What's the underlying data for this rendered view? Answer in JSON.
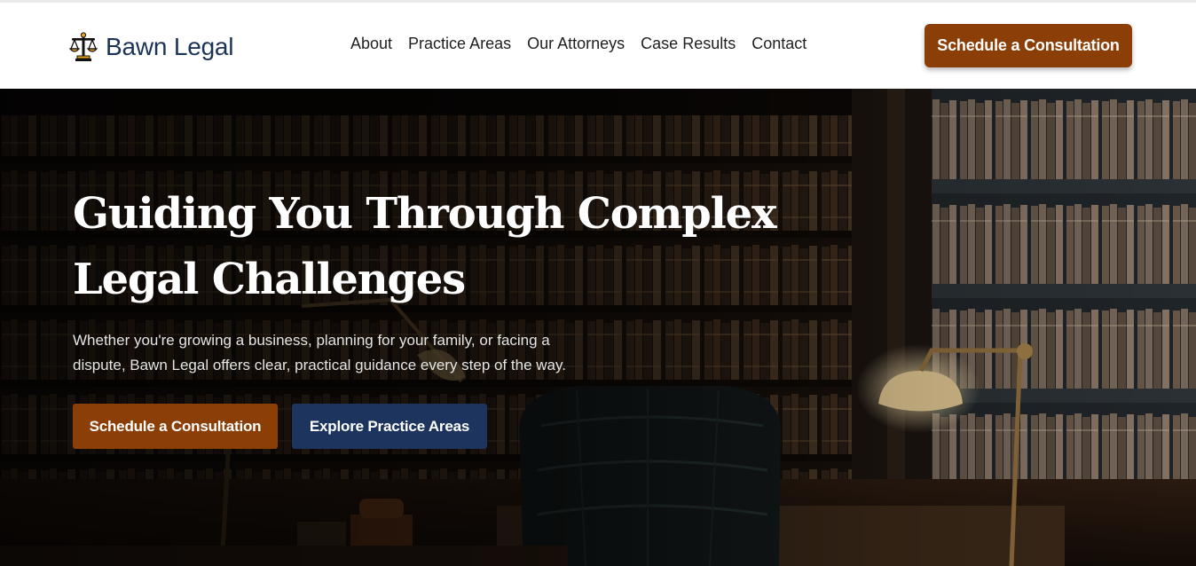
{
  "brand": {
    "name": "Bawn Legal",
    "icon": "scales-of-justice-icon"
  },
  "nav": {
    "items": [
      {
        "label": "About"
      },
      {
        "label": "Practice Areas"
      },
      {
        "label": "Our Attorneys"
      },
      {
        "label": "Case Results"
      },
      {
        "label": "Contact"
      }
    ]
  },
  "header": {
    "cta_label": "Schedule a Consultation"
  },
  "hero": {
    "title": "Guiding You Through Complex Legal Challenges",
    "subtitle": "Whether you're growing a business, planning for your family, or facing a dispute, Bawn Legal offers clear, practical guidance every step of the way.",
    "primary_button": "Schedule a Consultation",
    "secondary_button": "Explore Practice Areas",
    "background_image": "law-library-office-photo"
  },
  "colors": {
    "brand_navy": "#1c3358",
    "accent_brown": "#8b3f06",
    "button_navy": "#1d355e",
    "icon_gold": "#e8a21c"
  }
}
